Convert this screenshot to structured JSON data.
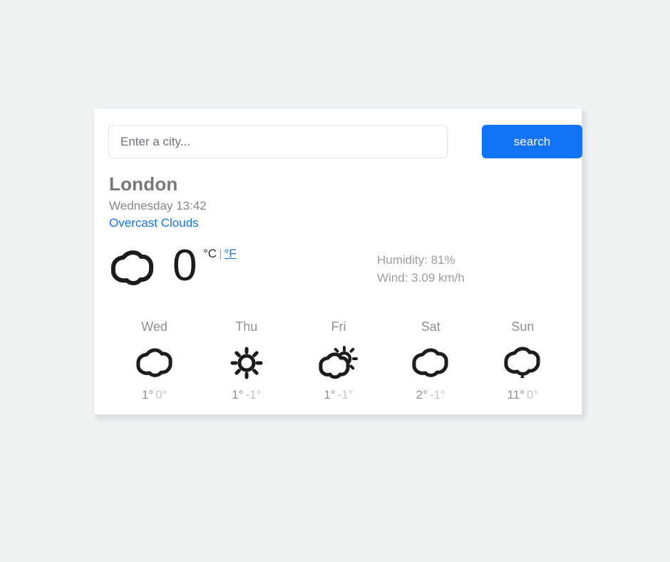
{
  "theme": {
    "page_background": "#eef2f3",
    "card_background": "#ffffff",
    "accent_blue": "#1273f5",
    "muted_text": "#8d9093"
  },
  "search": {
    "placeholder": "Enter a city...",
    "value": "",
    "button_label": "search"
  },
  "current": {
    "city": "London",
    "datetime": "Wednesday 13:42",
    "condition": "Overcast Clouds",
    "condition_icon": "cloud-icon",
    "temperature": "0",
    "unit_celsius": "°C",
    "unit_separator": "|",
    "unit_fahrenheit": "°F",
    "humidity": "Humidity: 81%",
    "wind": "Wind: 3.09 km/h"
  },
  "forecast": [
    {
      "day": "Wed",
      "icon": "cloud-icon",
      "high": "1°",
      "low": "0°"
    },
    {
      "day": "Thu",
      "icon": "sun-icon",
      "high": "1°",
      "low": "-1°"
    },
    {
      "day": "Fri",
      "icon": "sun-behind-cloud-icon",
      "high": "1°",
      "low": "-1°"
    },
    {
      "day": "Sat",
      "icon": "cloud-icon",
      "high": "2°",
      "low": "-1°"
    },
    {
      "day": "Sun",
      "icon": "cloud-drizzle-icon",
      "high": "11°",
      "low": "0°"
    }
  ]
}
